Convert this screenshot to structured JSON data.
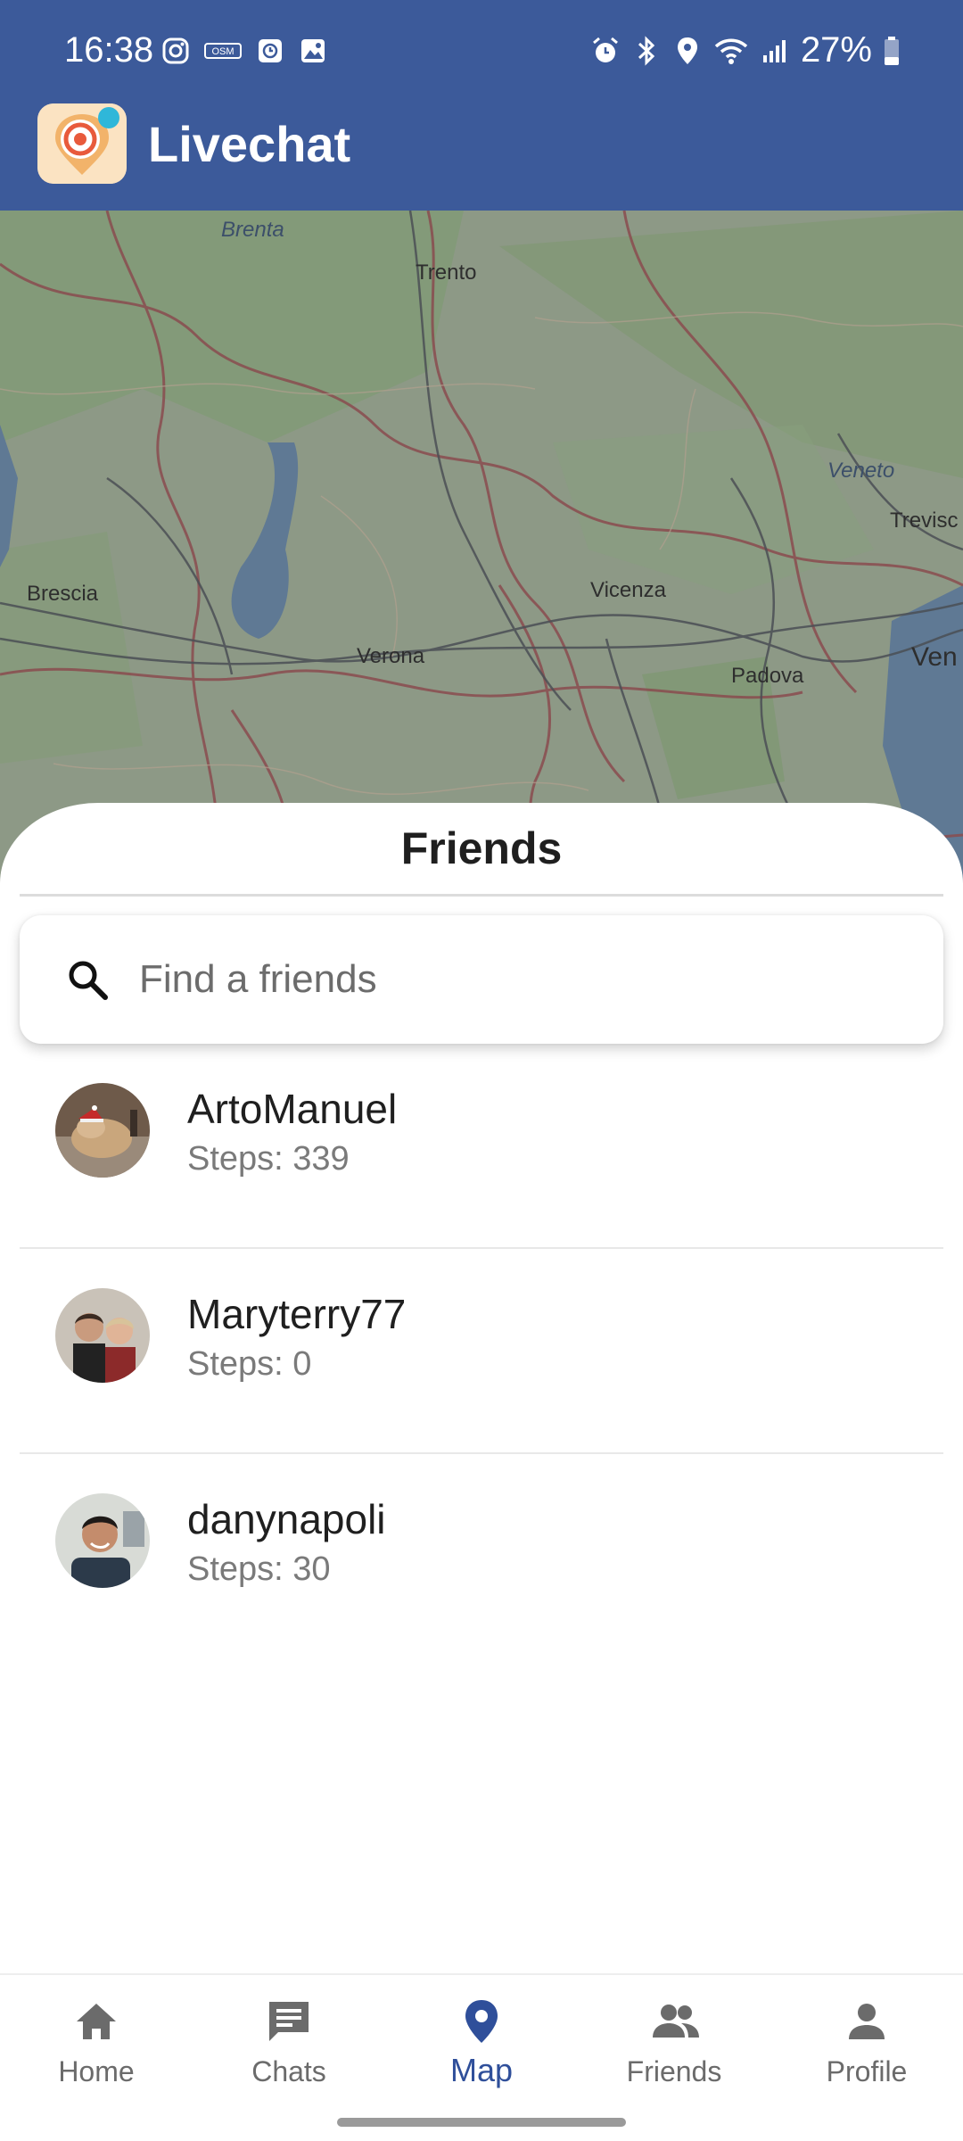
{
  "status_bar": {
    "time": "16:38",
    "battery": "27%",
    "left_icons": [
      "instagram-icon",
      "osm-icon",
      "clock-app-icon",
      "gallery-icon"
    ],
    "right_icons": [
      "alarm-icon",
      "bluetooth-icon",
      "location-icon",
      "wifi-icon",
      "signal-icon",
      "battery-icon"
    ]
  },
  "app_bar": {
    "title": "Livechat",
    "logo_icon": "livechat-logo-icon"
  },
  "map": {
    "labels": [
      {
        "text": "Brenta",
        "style": "italic"
      },
      {
        "text": "Trento",
        "style": "normal"
      },
      {
        "text": "Veneto",
        "style": "italic"
      },
      {
        "text": "Trevisc",
        "style": "normal"
      },
      {
        "text": "Brescia",
        "style": "normal"
      },
      {
        "text": "Vicenza",
        "style": "normal"
      },
      {
        "text": "Verona",
        "style": "normal"
      },
      {
        "text": "Padova",
        "style": "normal"
      },
      {
        "text": "Ven",
        "style": "normal"
      }
    ]
  },
  "sheet": {
    "title": "Friends",
    "search_placeholder": "Find a friends",
    "search_value": "",
    "friends": [
      {
        "name": "ArtoManuel",
        "steps": "Steps: 339",
        "avatar": "dog-avatar"
      },
      {
        "name": "Maryterry77",
        "steps": "Steps: 0",
        "avatar": "couple-avatar"
      },
      {
        "name": "danynapoli",
        "steps": "Steps: 30",
        "avatar": "man-avatar"
      }
    ]
  },
  "bottom_nav": {
    "active": "Map",
    "items": [
      {
        "label": "Home",
        "icon": "home-icon"
      },
      {
        "label": "Chats",
        "icon": "chat-icon"
      },
      {
        "label": "Map",
        "icon": "map-pin-icon"
      },
      {
        "label": "Friends",
        "icon": "people-icon"
      },
      {
        "label": "Profile",
        "icon": "person-icon"
      }
    ]
  },
  "colors": {
    "app_bar": "#3c5a9a",
    "accent": "#2f4f9a",
    "map_dim": "#8f9b88"
  }
}
